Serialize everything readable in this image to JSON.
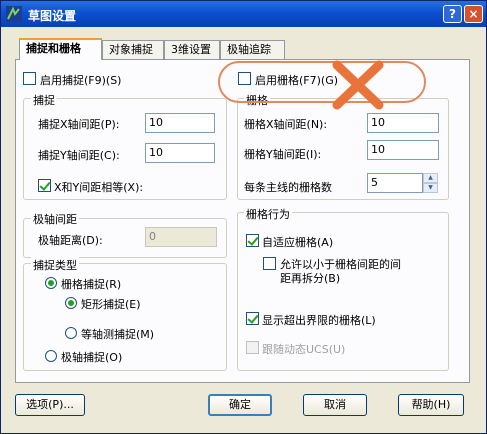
{
  "window": {
    "title": "草图设置",
    "help_glyph": "?",
    "close_glyph": "×"
  },
  "tabs": [
    {
      "label": "捕捉和栅格"
    },
    {
      "label": "对象捕捉"
    },
    {
      "label": "3维设置"
    },
    {
      "label": "极轴追踪"
    }
  ],
  "snap_enable": {
    "label": "启用捕捉(F9)(S)",
    "checked": false
  },
  "grid_enable": {
    "label": "启用栅格(F7)(G)",
    "checked": false
  },
  "snap_group": {
    "title": "捕捉",
    "x_label": "捕捉X轴间距(P):",
    "x_value": "10",
    "y_label": "捕捉Y轴间距(C):",
    "y_value": "10",
    "equal_label": "X和Y间距相等(X):",
    "equal_checked": true
  },
  "grid_group": {
    "title": "栅格",
    "x_label": "栅格X轴间距(N):",
    "x_value": "10",
    "y_label": "栅格Y轴间距(I):",
    "y_value": "10",
    "major_label": "每条主线的栅格数",
    "major_value": "5"
  },
  "polar_group": {
    "title": "极轴间距",
    "dist_label": "极轴距离(D):",
    "dist_value": "0"
  },
  "snap_type_group": {
    "title": "捕捉类型",
    "grid_snap": "栅格捕捉(R)",
    "rect_snap": "矩形捕捉(E)",
    "iso_snap": "等轴测捕捉(M)",
    "polar_snap": "极轴捕捉(O)"
  },
  "grid_behavior_group": {
    "title": "栅格行为",
    "adaptive": "自适应栅格(A)",
    "subdivide_line1": "允许以小于栅格间距的间",
    "subdivide_line2": "距再拆分(B)",
    "beyond_limits": "显示超出界限的栅格(L)",
    "follow_ucs": "跟随动态UCS(U)"
  },
  "buttons": {
    "options": "选项(P)...",
    "ok": "确定",
    "cancel": "取消",
    "help": "帮助(H)"
  },
  "colors": {
    "annotation": "#e8743b",
    "title_bar": "#0b4fd1"
  }
}
